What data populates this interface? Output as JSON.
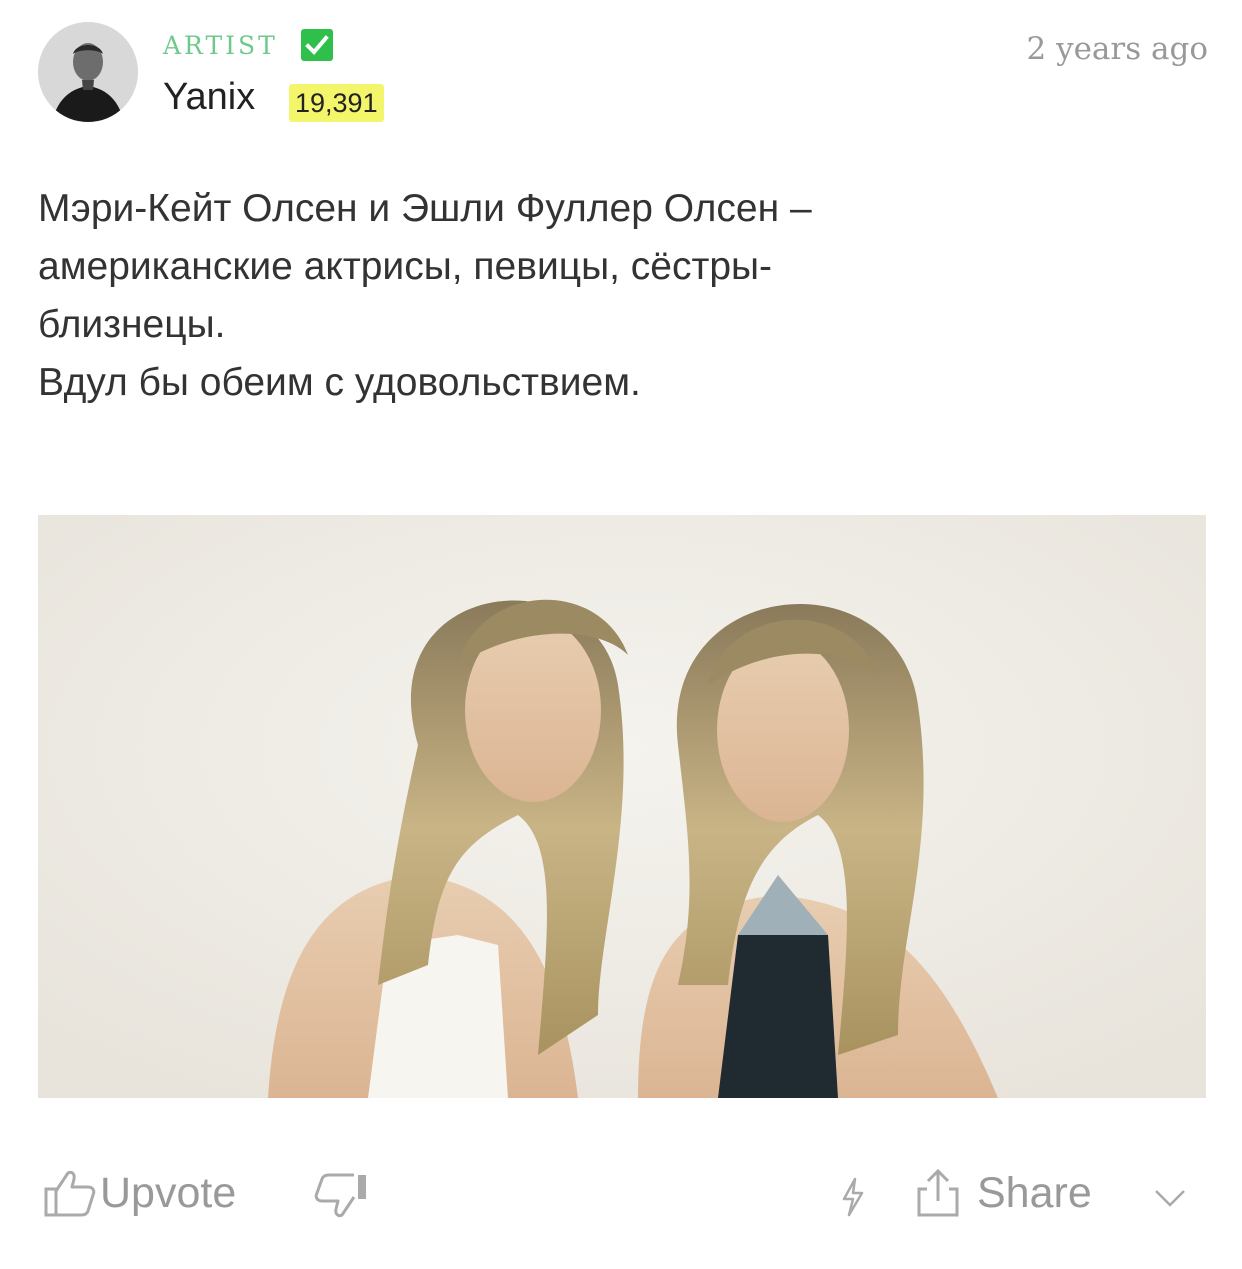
{
  "author": {
    "role": "ARTIST",
    "name": "Yanix",
    "karma": "19,391",
    "verified_color": "#2fbf4b",
    "karma_highlight": "#f3f56a"
  },
  "timestamp": "2 years ago",
  "post": {
    "text": "Мэри-Кейт Олсен и Эшли Фуллер Олсен –\nамериканские актрисы, певицы, сёстры-\nблизнецы.\nВдул бы обеим с удовольствием."
  },
  "actions": {
    "upvote_label": "Upvote",
    "share_label": "Share",
    "icons": [
      "thumbs-up-icon",
      "thumbs-down-icon",
      "lightning-icon",
      "share-icon",
      "chevron-down-icon"
    ]
  }
}
